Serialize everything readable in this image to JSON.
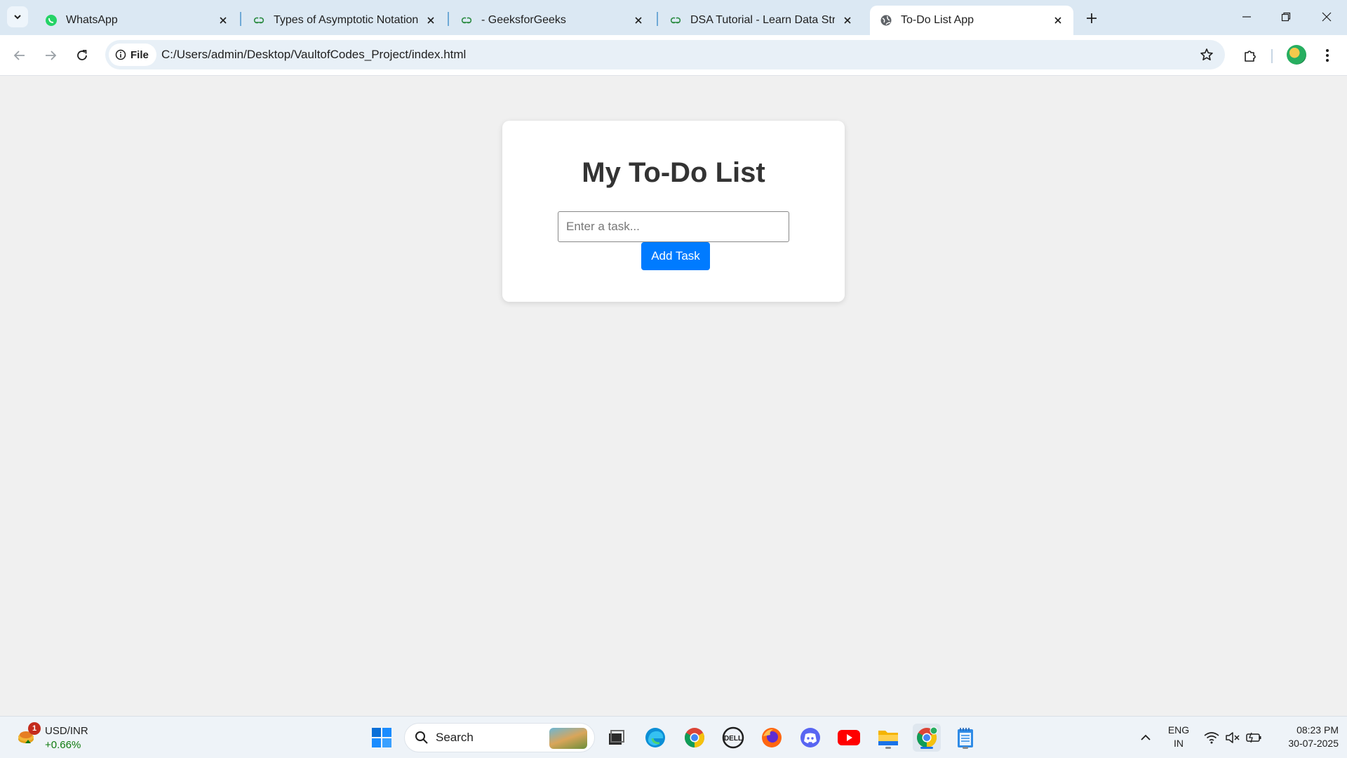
{
  "browser": {
    "tabs": [
      {
        "title": "WhatsApp",
        "icon": "whatsapp-icon"
      },
      {
        "title": "Types of Asymptotic Notations",
        "icon": "geeksforgeeks-icon"
      },
      {
        "title": "- GeeksforGeeks",
        "icon": "geeksforgeeks-icon"
      },
      {
        "title": "DSA Tutorial - Learn Data Struct",
        "icon": "geeksforgeeks-icon"
      },
      {
        "title": "To-Do List App",
        "icon": "globe-icon",
        "active": true
      }
    ],
    "site_chip_label": "File",
    "url": "C:/Users/admin/Desktop/VaultofCodes_Project/index.html"
  },
  "page": {
    "heading": "My To-Do List",
    "task_input": {
      "placeholder": "Enter a task...",
      "value": ""
    },
    "add_button_label": "Add Task"
  },
  "taskbar": {
    "widget": {
      "badge": "1",
      "title": "USD/INR",
      "change": "+0.66%"
    },
    "search_label": "Search",
    "apps": [
      "windows-start-icon",
      "task-view-icon",
      "edge-icon",
      "chrome-icon",
      "dell-icon",
      "firefox-icon",
      "discord-icon",
      "youtube-icon",
      "file-explorer-icon",
      "chrome-icon",
      "notepad-icon"
    ],
    "language": {
      "line1": "ENG",
      "line2": "IN"
    },
    "clock": {
      "time": "08:23 PM",
      "date": "30-07-2025"
    }
  },
  "colors": {
    "accent_button": "#007bff",
    "tab_strip": "#dbe8f3",
    "page_background": "#f0f0f0"
  }
}
